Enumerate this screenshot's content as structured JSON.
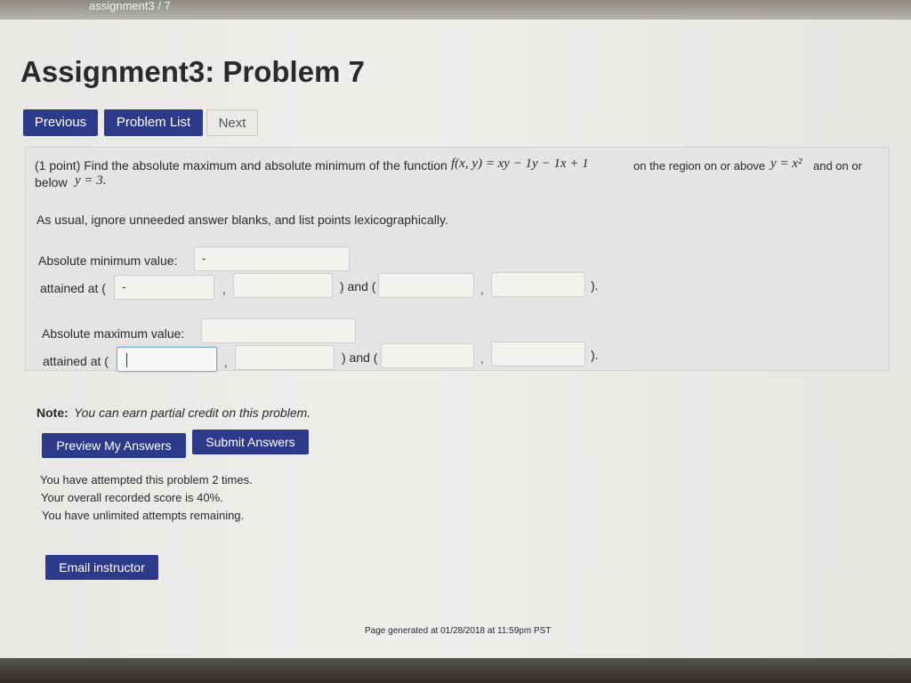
{
  "breadcrumb": "assignment3 / 7",
  "title": "Assignment3: Problem 7",
  "nav": {
    "previous": "Previous",
    "problem_list": "Problem List",
    "next": "Next"
  },
  "problem": {
    "intro": "(1 point) Find the absolute maximum and absolute minimum of the function",
    "function": "f(x, y) = xy − 1y − 1x + 1",
    "region_text": "on the region on or above",
    "region_math": "y = x²",
    "and_on_or": "and on or",
    "below": "below",
    "below_math": "y = 3.",
    "instructions": "As usual, ignore unneeded answer blanks, and list points lexicographically.",
    "min_label": "Absolute minimum value:",
    "min_value": "-",
    "attained_open": "attained at (",
    "comma": ",",
    "and_open": ") and (",
    "close": ").",
    "min_point1_x": "-",
    "max_label": "Absolute maximum value:"
  },
  "note_label": "Note:",
  "note_text": "You can earn partial credit on this problem.",
  "buttons": {
    "preview": "Preview My Answers",
    "submit": "Submit Answers",
    "email": "Email instructor"
  },
  "status": {
    "attempts": "You have attempted this problem 2 times.",
    "score": "Your overall recorded score is 40%.",
    "remaining": "You have unlimited attempts remaining."
  },
  "footer": "Page generated at 01/28/2018 at 11:59pm PST"
}
